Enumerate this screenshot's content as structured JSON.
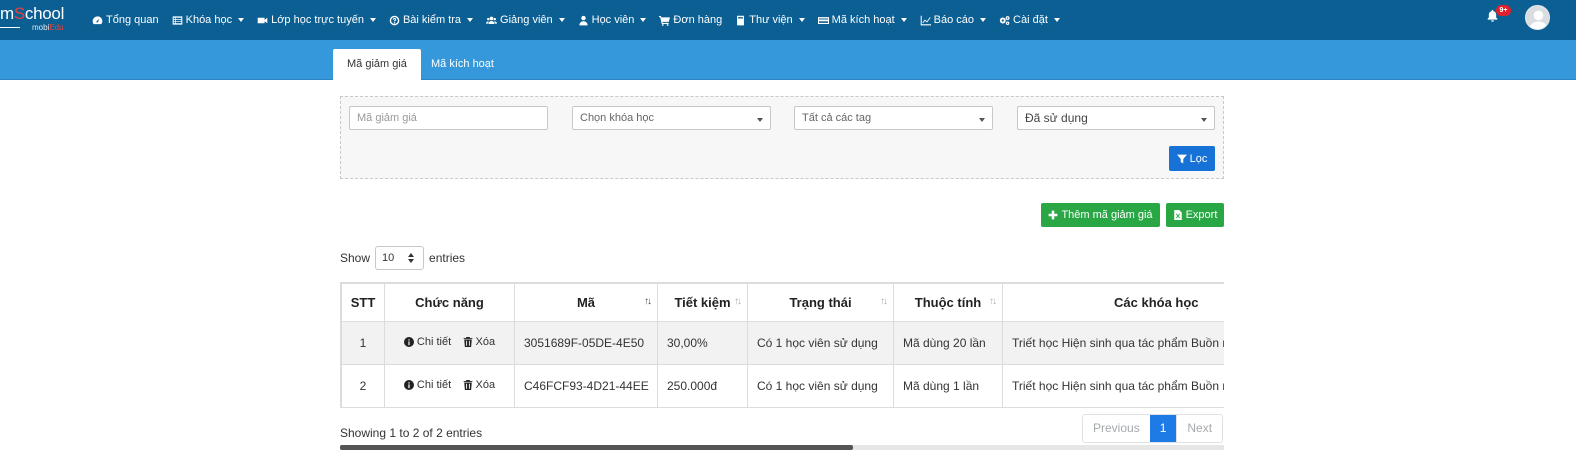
{
  "brand": {
    "part1": "m",
    "part2": "S",
    "part3": "chool",
    "sub1": "mobi",
    "sub2": "Edu"
  },
  "nav": [
    {
      "label": "Tổng quan",
      "icon": "dashboard-icon",
      "caret": false
    },
    {
      "label": "Khóa học",
      "icon": "list-icon",
      "caret": true
    },
    {
      "label": "Lớp học trực tuyến",
      "icon": "video-camera-icon",
      "caret": true
    },
    {
      "label": "Bài kiểm tra",
      "icon": "question-circle-icon",
      "caret": true
    },
    {
      "label": "Giảng viên",
      "icon": "users-icon",
      "caret": true
    },
    {
      "label": "Học viên",
      "icon": "user-icon",
      "caret": true
    },
    {
      "label": "Đơn hàng",
      "icon": "cart-icon",
      "caret": false
    },
    {
      "label": "Thư viện",
      "icon": "book-icon",
      "caret": true
    },
    {
      "label": "Mã kích hoạt",
      "icon": "credit-card-icon",
      "caret": true
    },
    {
      "label": "Báo cáo",
      "icon": "line-chart-icon",
      "caret": true
    },
    {
      "label": "Cài đặt",
      "icon": "gears-icon",
      "caret": true
    }
  ],
  "notifications": {
    "badge": "9+"
  },
  "tabs": [
    {
      "label": "Mã giảm giá",
      "active": true
    },
    {
      "label": "Mã kích hoạt",
      "active": false
    }
  ],
  "filters": {
    "code_placeholder": "Mã giảm giá",
    "course_select": "Chọn khóa học",
    "tag_select": "Tất cả các tag",
    "usage_select": "Đã sử dụng",
    "filter_button": "Lọc"
  },
  "actions": {
    "add_label": "Thêm mã giảm giá",
    "export_label": "Export"
  },
  "length_menu": {
    "show": "Show",
    "value": "10",
    "entries": "entries"
  },
  "table": {
    "columns": [
      "STT",
      "Chức năng",
      "Mã",
      "Tiết kiệm",
      "Trạng thái",
      "Thuộc tính",
      "Các khóa học"
    ],
    "detail_label": "Chi tiết",
    "delete_label": "Xóa",
    "rows": [
      {
        "stt": "1",
        "code": "3051689F-05DE-4E50",
        "saving": "30,00%",
        "status": "Có 1 học viên sử dụng",
        "attr": "Mã dùng 20 lần",
        "courses": "Triết học Hiện sinh qua tác phẩm Buồn nôn"
      },
      {
        "stt": "2",
        "code": "C46FCF93-4D21-44EE",
        "saving": "250.000đ",
        "status": "Có 1 học viên sử dụng",
        "attr": "Mã dùng 1 lần",
        "courses": "Triết học Hiện sinh qua tác phẩm Buồn nôn"
      }
    ]
  },
  "footer": {
    "info": "Showing 1 to 2 of 2 entries",
    "previous": "Previous",
    "page": "1",
    "next": "Next"
  },
  "colors": {
    "nav": "#0b5f93",
    "tabbar": "#3498db",
    "primary": "#1672d6",
    "success": "#2aa745",
    "badge": "#e0202a"
  }
}
